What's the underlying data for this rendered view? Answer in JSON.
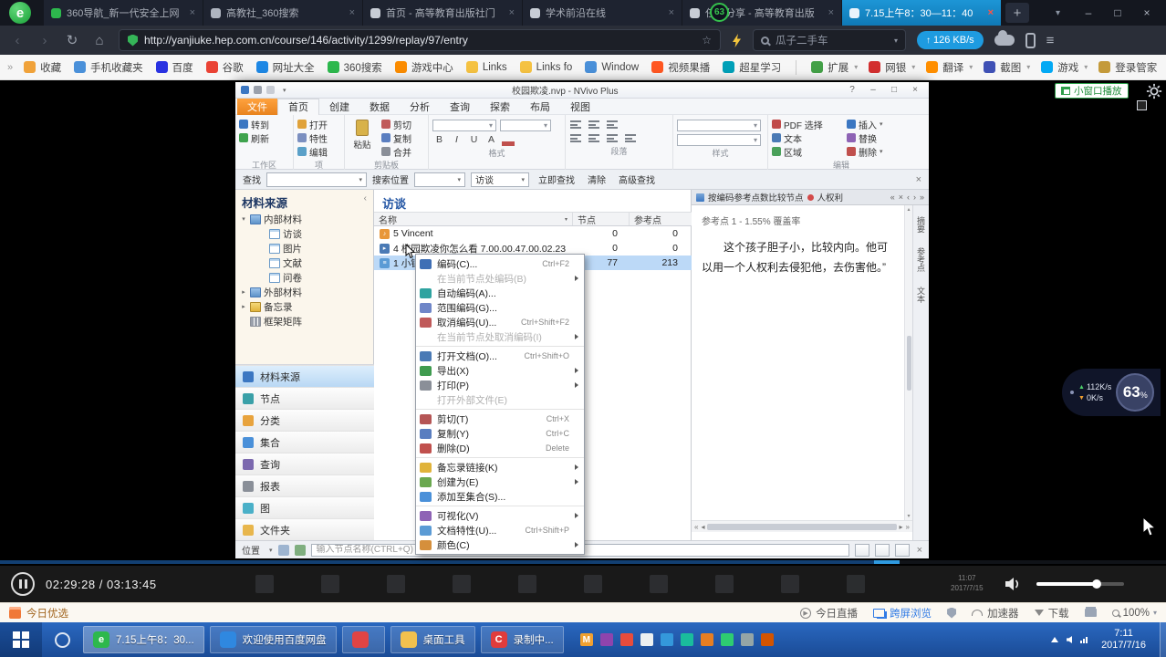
{
  "theme": {
    "tab-active": "#1d96d6",
    "accent-blue": "#1e9be0",
    "taskbar-blue": "#2a68c0",
    "selection-blue": "#bcd9f7",
    "nvivo-accent": "#e8831e",
    "badge-green": "#35c24d",
    "link-blue": "#2f7ae5"
  },
  "browser": {
    "logo_glyph": "e",
    "tabs": [
      {
        "label": "360导航_新一代安全上网",
        "fav": "#2db84d",
        "active": false
      },
      {
        "label": "高教社_360搜索",
        "fav": "#aeb4bf",
        "active": false
      },
      {
        "label": "首页 - 高等教育出版社门",
        "fav": "#c8cdd6",
        "active": false
      },
      {
        "label": "学术前沿在线",
        "fav": "#c8cdd6",
        "active": false
      },
      {
        "label": "任务分享 - 高等教育出版",
        "fav": "#c8cdd6",
        "active": false
      },
      {
        "label": "7.15上午8：30—11：40",
        "fav": "#eaf3fb",
        "active": true
      }
    ],
    "download_badge": "63",
    "new_tab_glyph": "+",
    "url": "http://yanjiuke.hep.com.cn/course/146/activity/1299/replay/97/entry",
    "search_placeholder": "瓜子二手车",
    "net_speed": "126 KB/s",
    "bookmarks": [
      {
        "label": "收藏",
        "color": "#f0a23a"
      },
      {
        "label": "手机收藏夹",
        "color": "#4a90d9"
      },
      {
        "label": "百度",
        "color": "#2932e1"
      },
      {
        "label": "谷歌",
        "color": "#ea4335"
      },
      {
        "label": "网址大全",
        "color": "#1e88e5"
      },
      {
        "label": "360搜索",
        "color": "#2db84d"
      },
      {
        "label": "游戏中心",
        "color": "#fb8c00"
      },
      {
        "label": "Links",
        "color": "#f5c242"
      },
      {
        "label": "Links fo",
        "color": "#f5c242"
      },
      {
        "label": "Window",
        "color": "#4a90d9"
      },
      {
        "label": "视频果播",
        "color": "#ff5722"
      },
      {
        "label": "超星学习",
        "color": "#00a0b8"
      }
    ],
    "tools": [
      {
        "label": "扩展",
        "color": "#43a047",
        "caret": true
      },
      {
        "label": "网银",
        "color": "#d32f2f",
        "caret": true
      },
      {
        "label": "翻译",
        "color": "#ff8f00",
        "caret": true
      },
      {
        "label": "截图",
        "color": "#3f51b5",
        "caret": true
      },
      {
        "label": "游戏",
        "color": "#03a9f4",
        "caret": true
      },
      {
        "label": "登录管家",
        "color": "#c49a3a",
        "caret": false
      }
    ]
  },
  "nvivo": {
    "title": "校园欺凌.nvp - NVivo Plus",
    "menu_tabs": [
      {
        "label": "文件",
        "accent": true
      },
      {
        "label": "首页",
        "selected": true
      },
      {
        "label": "创建"
      },
      {
        "label": "数据"
      },
      {
        "label": "分析"
      },
      {
        "label": "查询"
      },
      {
        "label": "探索"
      },
      {
        "label": "布局"
      },
      {
        "label": "视图"
      }
    ],
    "ribbon": {
      "workspace": {
        "label": "工作区",
        "items": [
          {
            "t": "转到",
            "c": "#3b77c2"
          },
          {
            "t": "刷新",
            "c": "#3fa34d"
          }
        ]
      },
      "item": {
        "label": "项",
        "items": [
          {
            "t": "打开",
            "c": "#e0a23a"
          },
          {
            "t": "特性",
            "c": "#7b8fc0"
          },
          {
            "t": "编辑",
            "c": "#5aa0c8"
          }
        ]
      },
      "clipboard": {
        "label": "剪贴板",
        "paste": "粘贴",
        "items": [
          {
            "t": "剪切",
            "c": "#c05a5a"
          },
          {
            "t": "复制",
            "c": "#5a7ec0"
          },
          {
            "t": "合并",
            "c": "#8a8f98"
          }
        ]
      },
      "format": {
        "label": "格式",
        "buttons": [
          "B",
          "I",
          "U",
          "A"
        ]
      },
      "paragraph": {
        "label": "段落"
      },
      "styles": {
        "label": "样式"
      },
      "editing": {
        "label": "编辑",
        "col1": [
          {
            "t": "PDF 选择",
            "c": "#c04a4a"
          },
          {
            "t": "文本",
            "c": "#4a7ab5"
          },
          {
            "t": "区域",
            "c": "#4aa05a"
          }
        ],
        "col2": [
          {
            "t": "插入",
            "c": "#3b77c2",
            "caret": true
          },
          {
            "t": "替换",
            "c": "#8e63b5"
          },
          {
            "t": "删除",
            "c": "#c0504d",
            "caret": true
          }
        ]
      }
    },
    "findbar": {
      "find": "查找",
      "location": "搜索位置",
      "scope": "访谈",
      "go": "立即查找",
      "clear": "清除",
      "advanced": "高级查找"
    },
    "sources": {
      "header": "材料来源",
      "tree": [
        {
          "label": "内部材料",
          "type": "ic-folder",
          "caret": "▾"
        },
        {
          "label": "访谈",
          "type": "ic-doc",
          "ind": "tr-ind"
        },
        {
          "label": "图片",
          "type": "ic-doc",
          "ind": "tr-ind"
        },
        {
          "label": "文献",
          "type": "ic-doc",
          "ind": "tr-ind"
        },
        {
          "label": "问卷",
          "type": "ic-doc",
          "ind": "tr-ind"
        },
        {
          "label": "外部材料",
          "type": "ic-folder",
          "caret": "▸"
        },
        {
          "label": "备忘录",
          "type": "ic-memo",
          "caret": "▸"
        },
        {
          "label": "框架矩阵",
          "type": "ic-matrix"
        }
      ],
      "nav": [
        {
          "label": "材料来源",
          "color": "#3b77c2",
          "active": true
        },
        {
          "label": "节点",
          "color": "#3aa0a8"
        },
        {
          "label": "分类",
          "color": "#e8a33d"
        },
        {
          "label": "集合",
          "color": "#4a90d9"
        },
        {
          "label": "查询",
          "color": "#7b68ae"
        },
        {
          "label": "报表",
          "color": "#8a8f98"
        },
        {
          "label": "图",
          "color": "#4ab0c8"
        },
        {
          "label": "文件夹",
          "color": "#e8b64c"
        }
      ]
    },
    "list": {
      "title": "访谈",
      "col_name": "名称",
      "col_nodes": "节点",
      "col_refs": "参考点",
      "rows": [
        {
          "name": "5 Vincent",
          "nodes": "0",
          "refs": "0",
          "type": "ic-audio",
          "glyph": "♪",
          "selected": false
        },
        {
          "name": "4 校园欺凌你怎么看 7.00.00.47.00.02.23",
          "nodes": "0",
          "refs": "0",
          "type": "ic-video",
          "glyph": "▸",
          "selected": false
        },
        {
          "name": "1 小钰",
          "nodes": "77",
          "refs": "213",
          "type": "ic-docrow",
          "glyph": "≡",
          "selected": true
        }
      ]
    },
    "context_menu": [
      {
        "label": "编码(C)...",
        "sc": "Ctrl+F2",
        "ic": "#3f6fb5"
      },
      {
        "label": "在当前节点处编码(B)",
        "dis": true,
        "sub": true,
        "ic": ""
      },
      {
        "label": "自动编码(A)...",
        "ic": "#2fa3a0"
      },
      {
        "label": "范围编码(G)...",
        "ic": "#6f86c8"
      },
      {
        "label": "取消编码(U)...",
        "sc": "Ctrl+Shift+F2",
        "ic": "#c05a5a"
      },
      {
        "label": "在当前节点处取消编码(I)",
        "dis": true,
        "sub": true,
        "ic": "",
        "sep": true
      },
      {
        "label": "打开文档(O)...",
        "sc": "Ctrl+Shift+O",
        "ic": "#4a7ab5"
      },
      {
        "label": "导出(X)",
        "sub": true,
        "ic": "#3f9b4f"
      },
      {
        "label": "打印(P)",
        "sub": true,
        "ic": "#8a8f98"
      },
      {
        "label": "打开外部文件(E)",
        "dis": true,
        "ic": "",
        "sep": true
      },
      {
        "label": "剪切(T)",
        "sc": "Ctrl+X",
        "ic": "#b55555"
      },
      {
        "label": "复制(Y)",
        "sc": "Ctrl+C",
        "ic": "#5a7ec0"
      },
      {
        "label": "删除(D)",
        "sc": "Delete",
        "ic": "#c0504d",
        "sep": true
      },
      {
        "label": "备忘录链接(K)",
        "sub": true,
        "ic": "#e0b33a"
      },
      {
        "label": "创建为(E)",
        "sub": true,
        "ic": "#6aa84f"
      },
      {
        "label": "添加至集合(S)...",
        "ic": "#4a90d9",
        "sep": true
      },
      {
        "label": "可视化(V)",
        "sub": true,
        "ic": "#8e63b5"
      },
      {
        "label": "文档特性(U)...",
        "sc": "Ctrl+Shift+P",
        "ic": "#5b9bd5"
      },
      {
        "label": "颜色(C)",
        "sub": true,
        "ic": "#d58f3c"
      }
    ],
    "detail": {
      "tab": "按编码参考点数比较节点",
      "node": "人权利",
      "ref_header": "参考点 1 - 1.55% 覆盖率",
      "text": "　　这个孩子胆子小，比较内向。他可以用一个人权利去侵犯他，去伤害他。”",
      "side_tabs": [
        "摘要",
        "参考点",
        "文本"
      ]
    },
    "statusbar": {
      "location": "位置",
      "placeholder": "输入节点名称(CTRL+Q)"
    }
  },
  "video": {
    "time": "02:29:28 / 03:13:45",
    "mini_window": "小窗口播放",
    "ghost_time": "11:07",
    "ghost_date": "2017/7/15"
  },
  "net_overlay": {
    "down": "112K/s",
    "up": "0K/s",
    "percent": "63",
    "unit": "%"
  },
  "shortcut_bar": {
    "featured": "今日优选",
    "live": "今日直播",
    "cross_screen": "跨屏浏览",
    "booster": "加速器",
    "download": "下载",
    "zoom": "100%"
  },
  "taskbar": {
    "apps": [
      {
        "label": "7.15上午8：30...",
        "color": "#2db84d",
        "glyph": "e",
        "active": true
      },
      {
        "label": "欢迎使用百度网盘",
        "color": "#2f88e0",
        "glyph": ""
      },
      {
        "label": "",
        "color": "#e04444",
        "glyph": ""
      },
      {
        "label": "桌面工具",
        "color": "#f2c14e",
        "glyph": ""
      },
      {
        "label": "录制中...",
        "color": "#e03c3c",
        "glyph": "C"
      }
    ],
    "tray": [
      {
        "glyph": "M",
        "color": "#f0a030"
      },
      {
        "glyph": "",
        "color": "#8e44ad"
      },
      {
        "glyph": "",
        "color": "#e74c3c"
      },
      {
        "glyph": "",
        "color": "#ecf0f1"
      },
      {
        "glyph": "",
        "color": "#3498db"
      },
      {
        "glyph": "",
        "color": "#1abc9c"
      },
      {
        "glyph": "",
        "color": "#e67e22"
      },
      {
        "glyph": "",
        "color": "#2ecc71"
      },
      {
        "glyph": "",
        "color": "#95a5a6"
      },
      {
        "glyph": "",
        "color": "#d35400"
      }
    ],
    "clock_time": "7:11",
    "clock_date": "2017/7/16"
  }
}
